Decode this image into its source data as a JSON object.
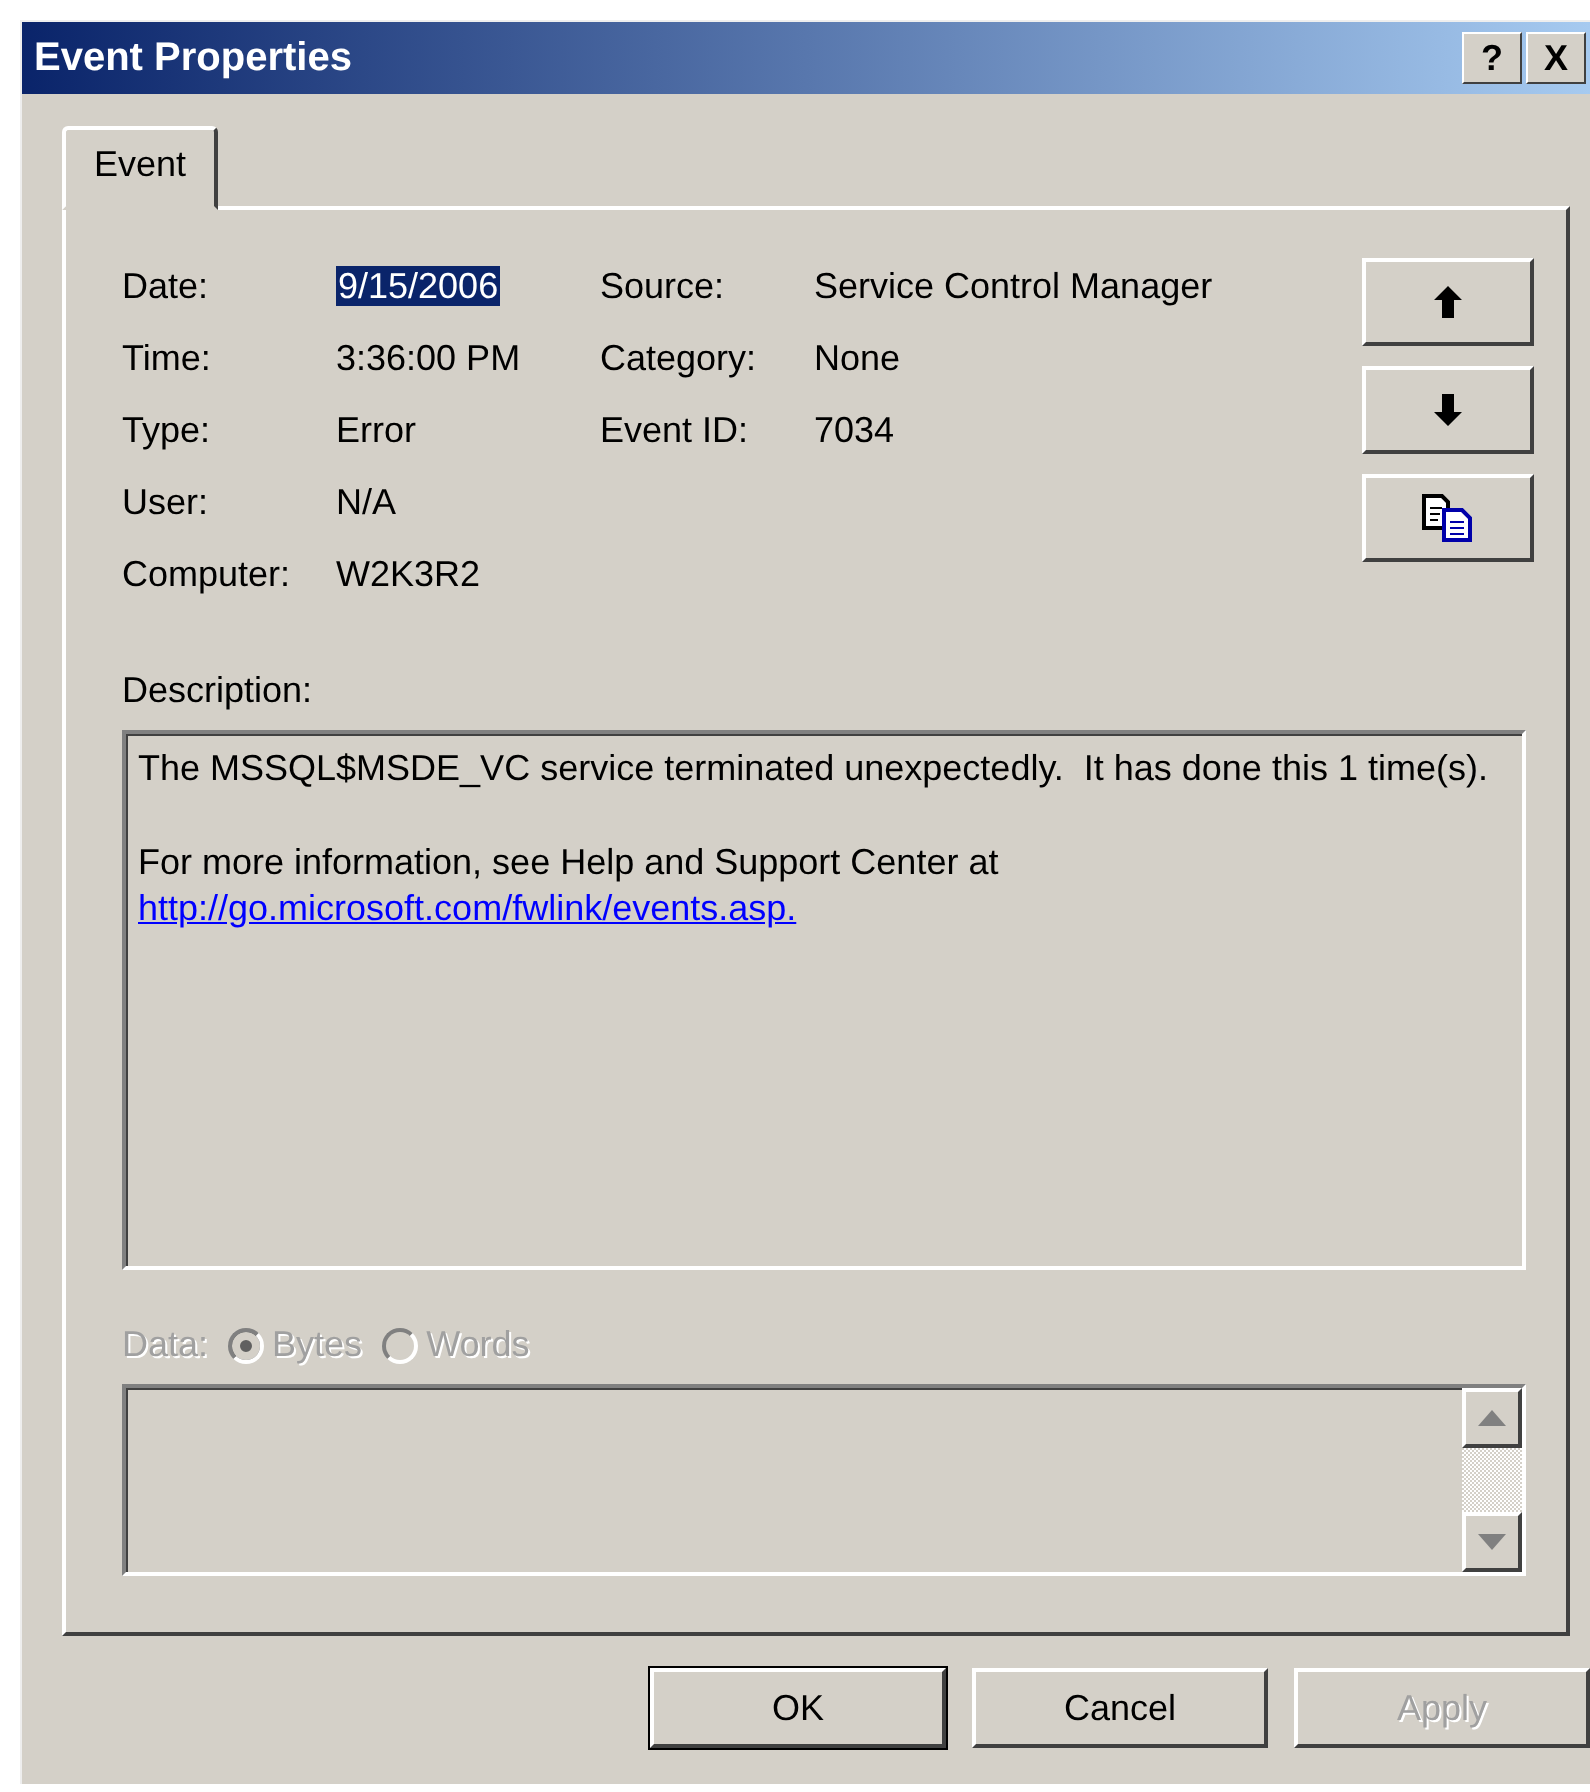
{
  "window": {
    "title": "Event Properties",
    "title_buttons": [
      "?",
      "X"
    ]
  },
  "tabs": [
    {
      "label": "Event",
      "selected": true
    }
  ],
  "left_fields": [
    {
      "label": "Date:",
      "value": "9/15/2006",
      "selected": true
    },
    {
      "label": "Time:",
      "value": "3:36:00 PM",
      "selected": false
    },
    {
      "label": "Type:",
      "value": "Error",
      "selected": false
    },
    {
      "label": "User:",
      "value": "N/A",
      "selected": false
    },
    {
      "label": "Computer:",
      "value": "W2K3R2",
      "selected": false
    }
  ],
  "right_fields": [
    {
      "label": "Source:",
      "value": "Service Control Manager"
    },
    {
      "label": "Category:",
      "value": "None"
    },
    {
      "label": "Event ID:",
      "value": "7034"
    }
  ],
  "nav_buttons": [
    {
      "kind": "up"
    },
    {
      "kind": "down"
    },
    {
      "kind": "copy"
    }
  ],
  "description": {
    "label": "Description:",
    "text": "The MSSQL$MSDE_VC service terminated unexpectedly.  It has done this 1 time(s).",
    "more": "For more information, see Help and Support Center at",
    "link": "http://go.microsoft.com/fwlink/events.asp."
  },
  "data": {
    "label": "Data:",
    "disabled": true,
    "options": [
      {
        "label": "Bytes",
        "selected": true
      },
      {
        "label": "Words",
        "selected": false
      }
    ]
  },
  "buttons": [
    {
      "label": "OK",
      "default": true,
      "disabled": false
    },
    {
      "label": "Cancel",
      "default": false,
      "disabled": false
    },
    {
      "label": "Apply",
      "default": false,
      "disabled": true
    }
  ]
}
